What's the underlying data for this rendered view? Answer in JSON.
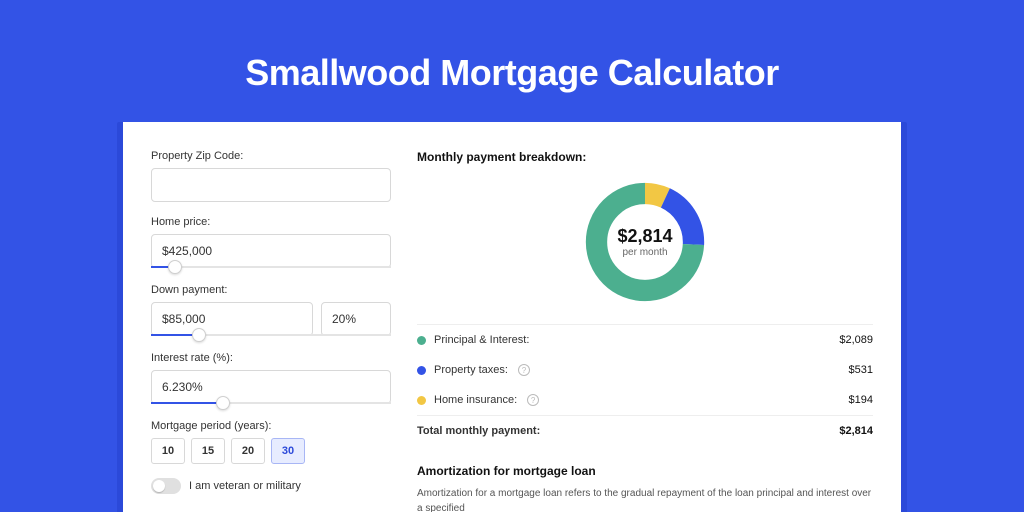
{
  "title": "Smallwood Mortgage Calculator",
  "form": {
    "zip_label": "Property Zip Code:",
    "zip_value": "",
    "home_price_label": "Home price:",
    "home_price_value": "$425,000",
    "home_price_slider_pct": 10,
    "down_payment_label": "Down payment:",
    "down_payment_value": "$85,000",
    "down_payment_pct": "20%",
    "down_payment_slider_pct": 20,
    "interest_label": "Interest rate (%):",
    "interest_value": "6.230%",
    "interest_slider_pct": 30,
    "period_label": "Mortgage period (years):",
    "periods": [
      "10",
      "15",
      "20",
      "30"
    ],
    "period_active_index": 3,
    "veteran_label": "I am veteran or military",
    "veteran_checked": false
  },
  "breakdown": {
    "title": "Monthly payment breakdown:",
    "center_amount": "$2,814",
    "center_sub": "per month",
    "items": [
      {
        "label": "Principal & Interest:",
        "value": "$2,089",
        "color": "green"
      },
      {
        "label": "Property taxes:",
        "value": "$531",
        "color": "blue",
        "info": true
      },
      {
        "label": "Home insurance:",
        "value": "$194",
        "color": "yellow",
        "info": true
      }
    ],
    "total_label": "Total monthly payment:",
    "total_value": "$2,814"
  },
  "chart_data": {
    "type": "pie",
    "title": "Monthly payment breakdown",
    "series": [
      {
        "name": "Principal & Interest",
        "value": 2089,
        "color": "#4caf8f"
      },
      {
        "name": "Property taxes",
        "value": 531,
        "color": "#3353e6"
      },
      {
        "name": "Home insurance",
        "value": 194,
        "color": "#f2c744"
      }
    ],
    "total": 2814,
    "center_label": "$2,814 per month"
  },
  "amortization": {
    "title": "Amortization for mortgage loan",
    "body": "Amortization for a mortgage loan refers to the gradual repayment of the loan principal and interest over a specified"
  }
}
